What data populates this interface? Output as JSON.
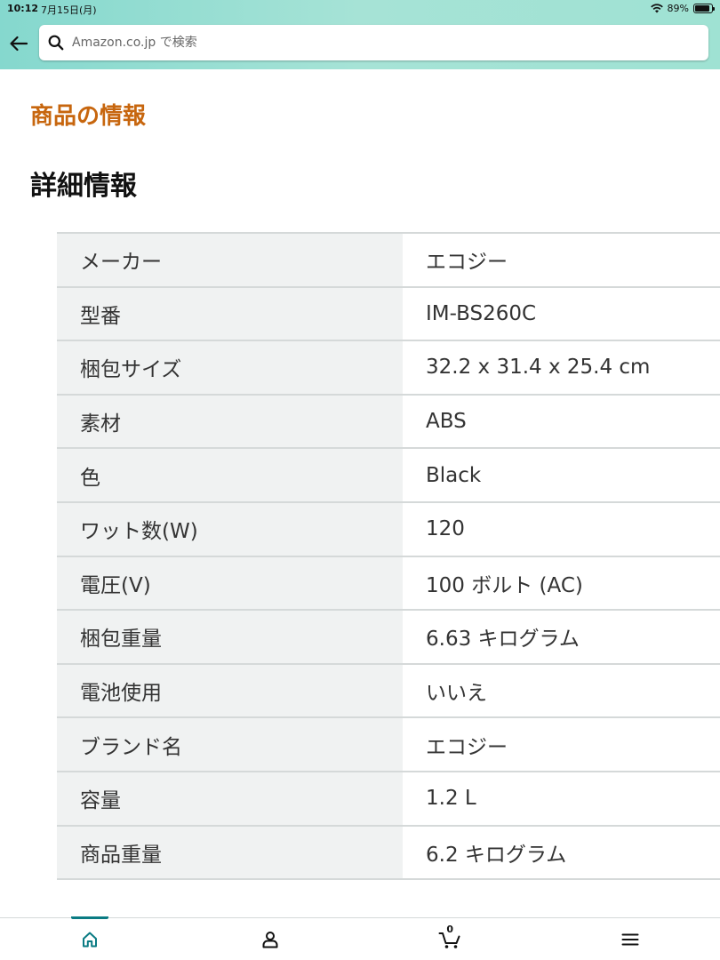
{
  "status_bar": {
    "time": "10:12",
    "date": "7月15日(月)",
    "battery_percent": "89%",
    "battery_level": 0.89
  },
  "header": {
    "search_placeholder": "Amazon.co.jp で検索"
  },
  "page": {
    "section_title": "商品の情報",
    "subsection_title": "詳細情報"
  },
  "specs": [
    {
      "label": "メーカー",
      "value": "エコジー"
    },
    {
      "label": "型番",
      "value": "IM-BS260C"
    },
    {
      "label": "梱包サイズ",
      "value": "32.2 x 31.4 x 25.4 cm"
    },
    {
      "label": "素材",
      "value": "ABS"
    },
    {
      "label": "色",
      "value": "Black"
    },
    {
      "label": "ワット数(W)",
      "value": "120"
    },
    {
      "label": "電圧(V)",
      "value": "100 ボルト (AC)"
    },
    {
      "label": "梱包重量",
      "value": "6.63 キログラム"
    },
    {
      "label": "電池使用",
      "value": "いいえ"
    },
    {
      "label": "ブランド名",
      "value": "エコジー"
    },
    {
      "label": "容量",
      "value": "1.2 L"
    },
    {
      "label": "商品重量",
      "value": "6.2 キログラム"
    }
  ],
  "bottom_nav": {
    "cart_count": "0",
    "items": [
      {
        "name": "home",
        "icon": "home-icon",
        "active": true
      },
      {
        "name": "account",
        "icon": "person-icon",
        "active": false
      },
      {
        "name": "cart",
        "icon": "cart-icon",
        "active": false
      },
      {
        "name": "menu",
        "icon": "hamburger-menu-icon",
        "active": false
      }
    ]
  },
  "colors": {
    "accent_orange": "#c7660e",
    "active_teal": "#0a7b83",
    "header_gradient_start": "#85d8ce",
    "header_gradient_end": "#9fe2d3",
    "table_label_bg": "#f0f2f2"
  }
}
